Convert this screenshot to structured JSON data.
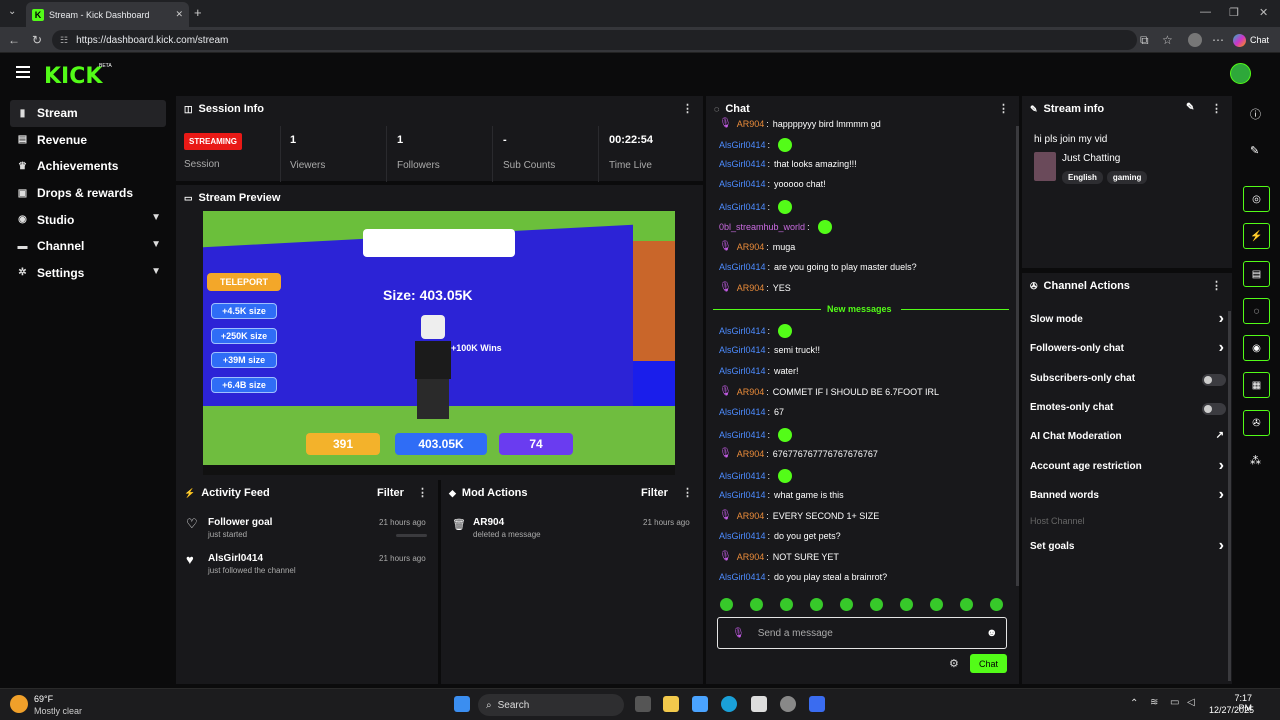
{
  "browser": {
    "tab_title": "Stream - Kick Dashboard",
    "url": "https://dashboard.kick.com/stream",
    "chat_pill": "Chat"
  },
  "app": {
    "logo": "KICK",
    "logo_badge": "BETA"
  },
  "sidebar": {
    "items": [
      {
        "label": "Stream",
        "icon": "stream-icon"
      },
      {
        "label": "Revenue",
        "icon": "revenue-icon"
      },
      {
        "label": "Achievements",
        "icon": "trophy-icon"
      },
      {
        "label": "Drops & rewards",
        "icon": "gift-icon"
      },
      {
        "label": "Studio",
        "icon": "studio-icon"
      },
      {
        "label": "Channel",
        "icon": "channel-icon"
      },
      {
        "label": "Settings",
        "icon": "gear-icon"
      }
    ]
  },
  "session": {
    "title": "Session Info",
    "badge": "STREAMING",
    "badge_label": "Session",
    "stats": [
      {
        "value": "1",
        "label": "Viewers"
      },
      {
        "value": "1",
        "label": "Followers"
      },
      {
        "value": "-",
        "label": "Sub Counts"
      },
      {
        "value": "00:22:54",
        "label": "Time Live"
      }
    ]
  },
  "preview": {
    "title": "Stream Preview",
    "game_text": {
      "size": "Size: 403.05K",
      "teleport": "TELEPORT",
      "pills": [
        "+4.5K size",
        "+250K size",
        "+39M size",
        "+6.4B size"
      ],
      "wins": "+100K Wins",
      "bottom": [
        "391",
        "403.05K",
        "74"
      ]
    }
  },
  "activity": {
    "title": "Activity Feed",
    "filter": "Filter",
    "items": [
      {
        "name": "Follower goal",
        "sub": "just started",
        "time": "21 hours ago"
      },
      {
        "name": "AlsGirl0414",
        "sub": "just followed the channel",
        "time": "21 hours ago"
      }
    ]
  },
  "mod": {
    "title": "Mod Actions",
    "filter": "Filter",
    "items": [
      {
        "name": "AR904",
        "sub": "deleted a message",
        "time": "21 hours ago"
      }
    ]
  },
  "chat": {
    "title": "Chat",
    "new_messages": "New messages",
    "messages": [
      {
        "user": "AR904",
        "text": "happppyyy bird lmmmm gd",
        "color": "o",
        "mic": true
      },
      {
        "user": "AlsGirl0414",
        "text": "",
        "color": "b",
        "emoji": true
      },
      {
        "user": "AlsGirl0414",
        "text": "that looks amazing!!!",
        "color": "b"
      },
      {
        "user": "AlsGirl0414",
        "text": "yooooo chat!",
        "color": "b"
      },
      {
        "user": "AlsGirl0414",
        "text": "",
        "color": "b",
        "emoji": true
      },
      {
        "user": "0bl_streamhub_world",
        "text": "",
        "color": "p",
        "emoji": true
      },
      {
        "user": "AR904",
        "text": "muga",
        "color": "o",
        "mic": true
      },
      {
        "user": "AlsGirl0414",
        "text": "are you going to play master duels?",
        "color": "b"
      },
      {
        "user": "AR904",
        "text": "YES",
        "color": "o",
        "mic": true
      },
      {
        "user": "AlsGirl0414",
        "text": "",
        "color": "b",
        "emoji": true
      },
      {
        "user": "AlsGirl0414",
        "text": "semi truck!!",
        "color": "b"
      },
      {
        "user": "AlsGirl0414",
        "text": "water!",
        "color": "b"
      },
      {
        "user": "AR904",
        "text": "COMMET IF I SHOULD BE 6.7FOOT IRL",
        "color": "o",
        "mic": true
      },
      {
        "user": "AlsGirl0414",
        "text": "67",
        "color": "b"
      },
      {
        "user": "AlsGirl0414",
        "text": "",
        "color": "b",
        "emoji": true
      },
      {
        "user": "AR904",
        "text": "676776767776767676767",
        "color": "o",
        "mic": true
      },
      {
        "user": "AlsGirl0414",
        "text": "",
        "color": "b",
        "emoji": true
      },
      {
        "user": "AlsGirl0414",
        "text": "what game is this",
        "color": "b"
      },
      {
        "user": "AR904",
        "text": "EVERY SECOND 1+ SIZE",
        "color": "o",
        "mic": true
      },
      {
        "user": "AlsGirl0414",
        "text": "do you get pets?",
        "color": "b"
      },
      {
        "user": "AR904",
        "text": "NOT SURE YET",
        "color": "o",
        "mic": true
      },
      {
        "user": "AlsGirl0414",
        "text": "do you play steal a brainrot?",
        "color": "b"
      }
    ],
    "placeholder": "Send a message",
    "send": "Chat"
  },
  "stream_info": {
    "title": "Stream info",
    "stream_title": "hi pls join my vid",
    "category": "Just Chatting",
    "tags": [
      "English",
      "gaming"
    ]
  },
  "channel_actions": {
    "title": "Channel Actions",
    "items": [
      {
        "label": "Slow mode",
        "type": "arrow"
      },
      {
        "label": "Followers-only chat",
        "type": "arrow"
      },
      {
        "label": "Subscribers-only chat",
        "type": "toggle"
      },
      {
        "label": "Emotes-only chat",
        "type": "toggle"
      },
      {
        "label": "AI Chat Moderation",
        "type": "external"
      },
      {
        "label": "Account age restriction",
        "type": "arrow"
      },
      {
        "label": "Banned words",
        "type": "arrow"
      },
      {
        "label": "Host Channel",
        "type": "disabled"
      },
      {
        "label": "Set goals",
        "type": "arrow"
      }
    ]
  },
  "taskbar": {
    "weather_temp": "69°F",
    "weather_desc": "Mostly clear",
    "search": "Search",
    "time": "7:17 PM",
    "date": "12/27/2025"
  },
  "colors": {
    "accent": "#53fc18",
    "live": "#e91916",
    "panel": "#18181b"
  }
}
